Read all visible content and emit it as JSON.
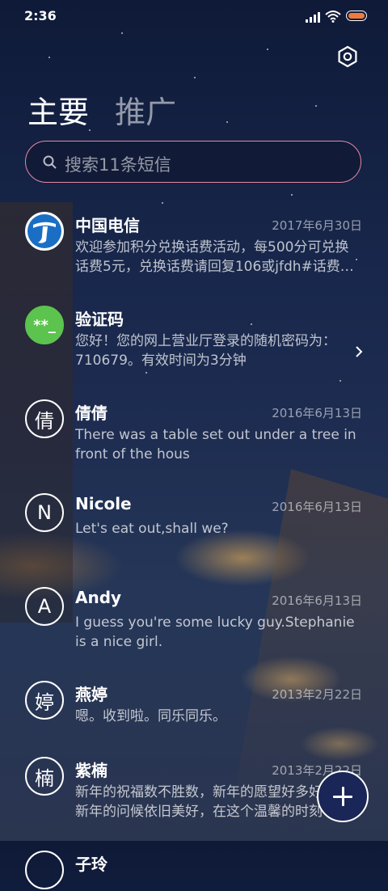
{
  "status": {
    "time": "2:36"
  },
  "tabs": [
    {
      "label": "主要"
    },
    {
      "label": "推广"
    }
  ],
  "search": {
    "placeholder": "搜索11条短信"
  },
  "conversations": [
    {
      "avatar": "",
      "name": "中国电信",
      "date": "2017年6月30日",
      "preview": "欢迎参加积分兑换话费活动，每500分可兑换话费5元，兑换话费请回复106或jfdh#话费…"
    },
    {
      "avatar": "**_",
      "name": "验证码",
      "date": "",
      "preview": "您好！您的网上营业厅登录的随机密码为：710679。有效时间为3分钟"
    },
    {
      "avatar": "倩",
      "name": "倩倩",
      "date": "2016年6月13日",
      "preview": "There was a table set out under a tree in front of the hous"
    },
    {
      "avatar": "N",
      "name": "Nicole",
      "date": "2016年6月13日",
      "preview": "Let's eat out,shall we?"
    },
    {
      "avatar": "A",
      "name": "Andy",
      "date": "2016年6月13日",
      "preview": "I guess you're some lucky guy.Stephanie is a nice girl."
    },
    {
      "avatar": "婷",
      "name": "燕婷",
      "date": "2013年2月22日",
      "preview": "嗯。收到啦。同乐同乐。"
    },
    {
      "avatar": "楠",
      "name": "紫楠",
      "date": "2013年2月22日",
      "preview": "新年的祝福数不胜数，新年的愿望好多好多，新年的问候依旧美好，在这个温馨的时刻"
    },
    {
      "avatar": "",
      "name": "子玲",
      "date": "",
      "preview": ""
    }
  ],
  "colors": {
    "accent": "#e58aa6",
    "fab": "#1a2657",
    "verify_green": "#5cc34e",
    "battery": "#f07a3a"
  },
  "icons": [
    "signal-icon",
    "wifi-icon",
    "battery-icon",
    "settings-icon",
    "search-icon",
    "chevron-right-icon",
    "add-icon"
  ]
}
